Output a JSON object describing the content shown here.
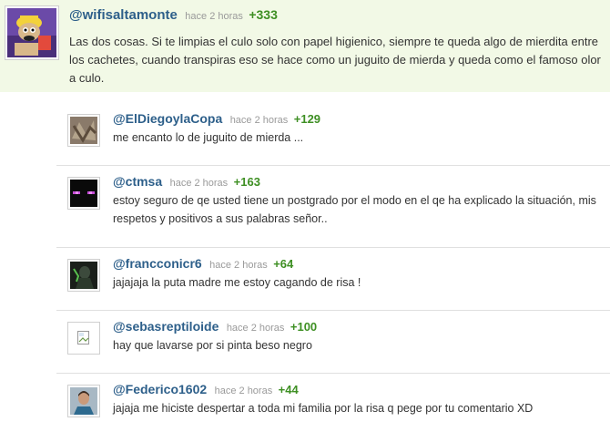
{
  "main": {
    "username": "@wifisaltamonte",
    "time": "hace 2 horas",
    "votes": "+333",
    "text": "Las dos cosas. Si te limpias el culo solo con papel higienico, siempre te queda algo de mierdita entre los cachetes, cuando transpiras eso se hace como un juguito de mierda y queda como el famoso olor a culo."
  },
  "replies": [
    {
      "username": "@ElDiegoylaCopa",
      "time": "hace 2 horas",
      "votes": "+129",
      "text": "me encanto lo de juguito de mierda ..."
    },
    {
      "username": "@ctmsa",
      "time": "hace 2 horas",
      "votes": "+163",
      "text": "estoy seguro de qe usted tiene un postgrado por el modo en el qe ha explicado la situación, mis respetos y positivos a sus palabras señor.."
    },
    {
      "username": "@francconicr6",
      "time": "hace 2 horas",
      "votes": "+64",
      "text": "jajajaja la puta madre me estoy cagando de risa !"
    },
    {
      "username": "@sebasreptiloide",
      "time": "hace 2 horas",
      "votes": "+100",
      "text": "hay que lavarse por si pinta beso negro"
    },
    {
      "username": "@Federico1602",
      "time": "hace 2 horas",
      "votes": "+44",
      "text": "jajaja me hiciste despertar a toda mi familia por la risa q pege por tu comentario XD"
    }
  ]
}
